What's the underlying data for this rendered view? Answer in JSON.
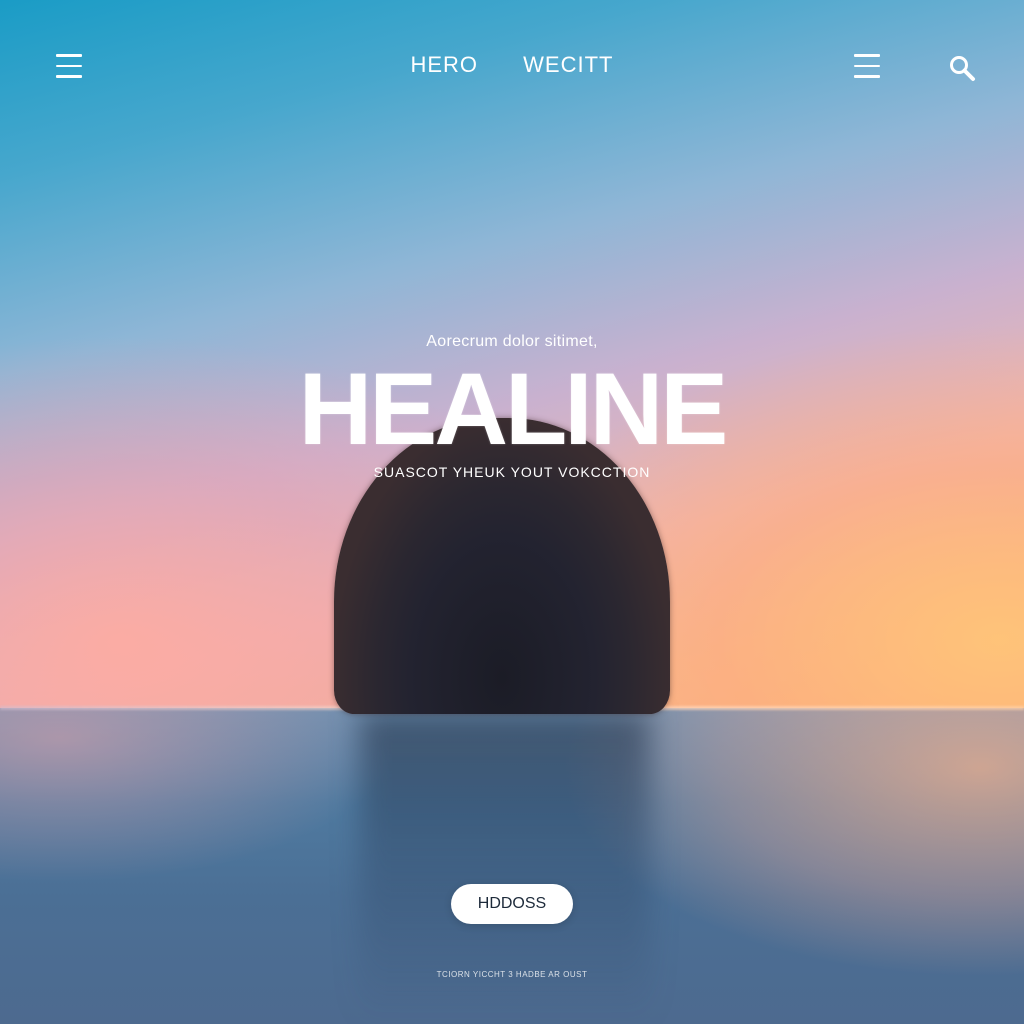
{
  "nav": {
    "brand_left": "HERO",
    "brand_right": "WECITT",
    "left_icon": "menu-icon",
    "right_icon": "menu-icon",
    "search_icon": "search-icon"
  },
  "hero": {
    "eyebrow": "Aorecrum dolor sitimet,",
    "headline": "HEALINE",
    "subline": "SUASCOT YHEUK YOUT VOKCCTION"
  },
  "cta": {
    "label": "HDDOSS"
  },
  "footer": {
    "text": "TCIORN YICCHT 3 HADBE AR OUST"
  },
  "colors": {
    "sky_top": "#1a9cc6",
    "sky_sunset": "#fbb37f",
    "water": "#4f7aa0",
    "text": "#ffffff",
    "button_bg": "#ffffff",
    "button_text": "#1d2a3a"
  }
}
